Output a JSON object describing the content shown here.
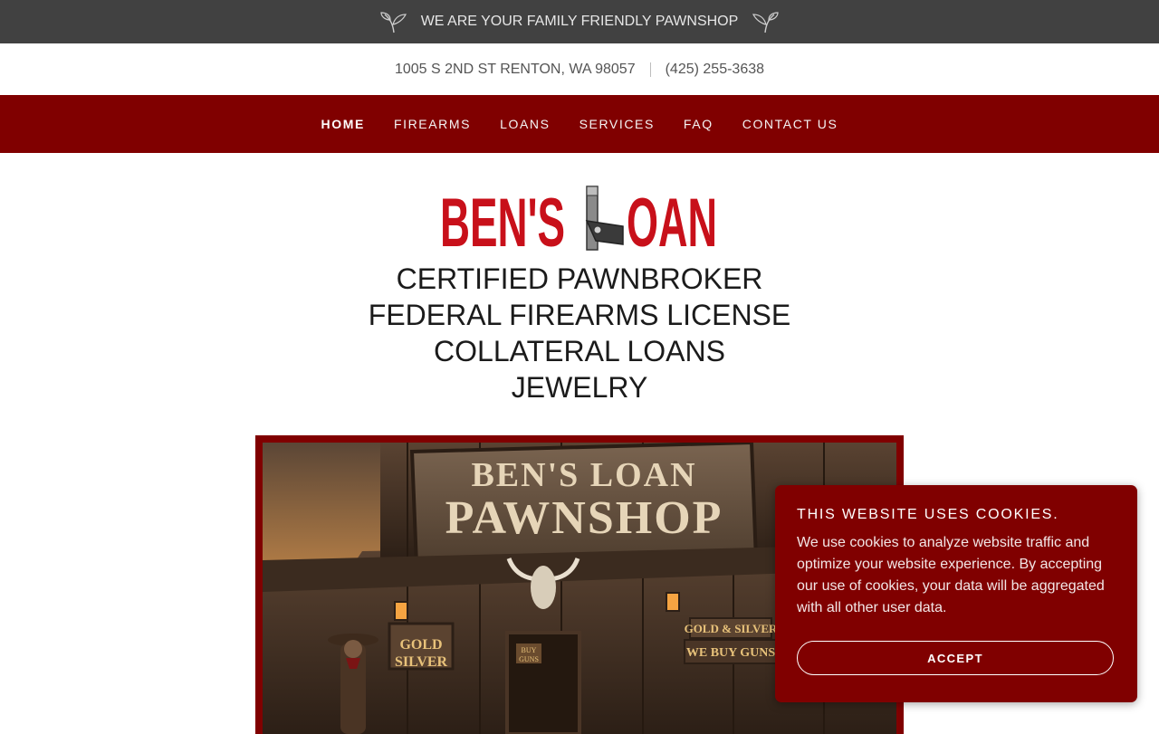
{
  "announcement": {
    "text": "WE ARE YOUR FAMILY FRIENDLY PAWNSHOP"
  },
  "contact": {
    "address": "1005 S 2ND ST RENTON, WA 98057",
    "phone": "(425) 255-3638"
  },
  "nav": {
    "items": [
      {
        "label": "HOME",
        "active": true
      },
      {
        "label": "FIREARMS"
      },
      {
        "label": "LOANS"
      },
      {
        "label": "SERVICES"
      },
      {
        "label": "FAQ"
      },
      {
        "label": "CONTACT US"
      }
    ]
  },
  "logo": {
    "text_left": "BEN'S",
    "text_right": "OAN"
  },
  "tagline": [
    "CERTIFIED PAWNBROKER",
    "FEDERAL FIREARMS LICENSE",
    "COLLATERAL LOANS",
    "JEWELRY"
  ],
  "hero": {
    "sign_line1": "BEN'S LOAN",
    "sign_line2": "PAWNSHOP",
    "left_sign": [
      "GOLD",
      "SILVER"
    ],
    "door_sign": [
      "BUY",
      "GUNS"
    ],
    "right_sign_top": "GOLD & SILVER",
    "right_sign_bottom": "WE BUY GUNS"
  },
  "cookie": {
    "title": "THIS WEBSITE USES COOKIES.",
    "body": "We use cookies to analyze website traffic and optimize your website experience. By accepting our use of cookies, your data will be aggregated with all other user data.",
    "accept_label": "ACCEPT"
  },
  "colors": {
    "brand": "#800000",
    "topbar": "#414141",
    "logo_red": "#c8101a"
  }
}
